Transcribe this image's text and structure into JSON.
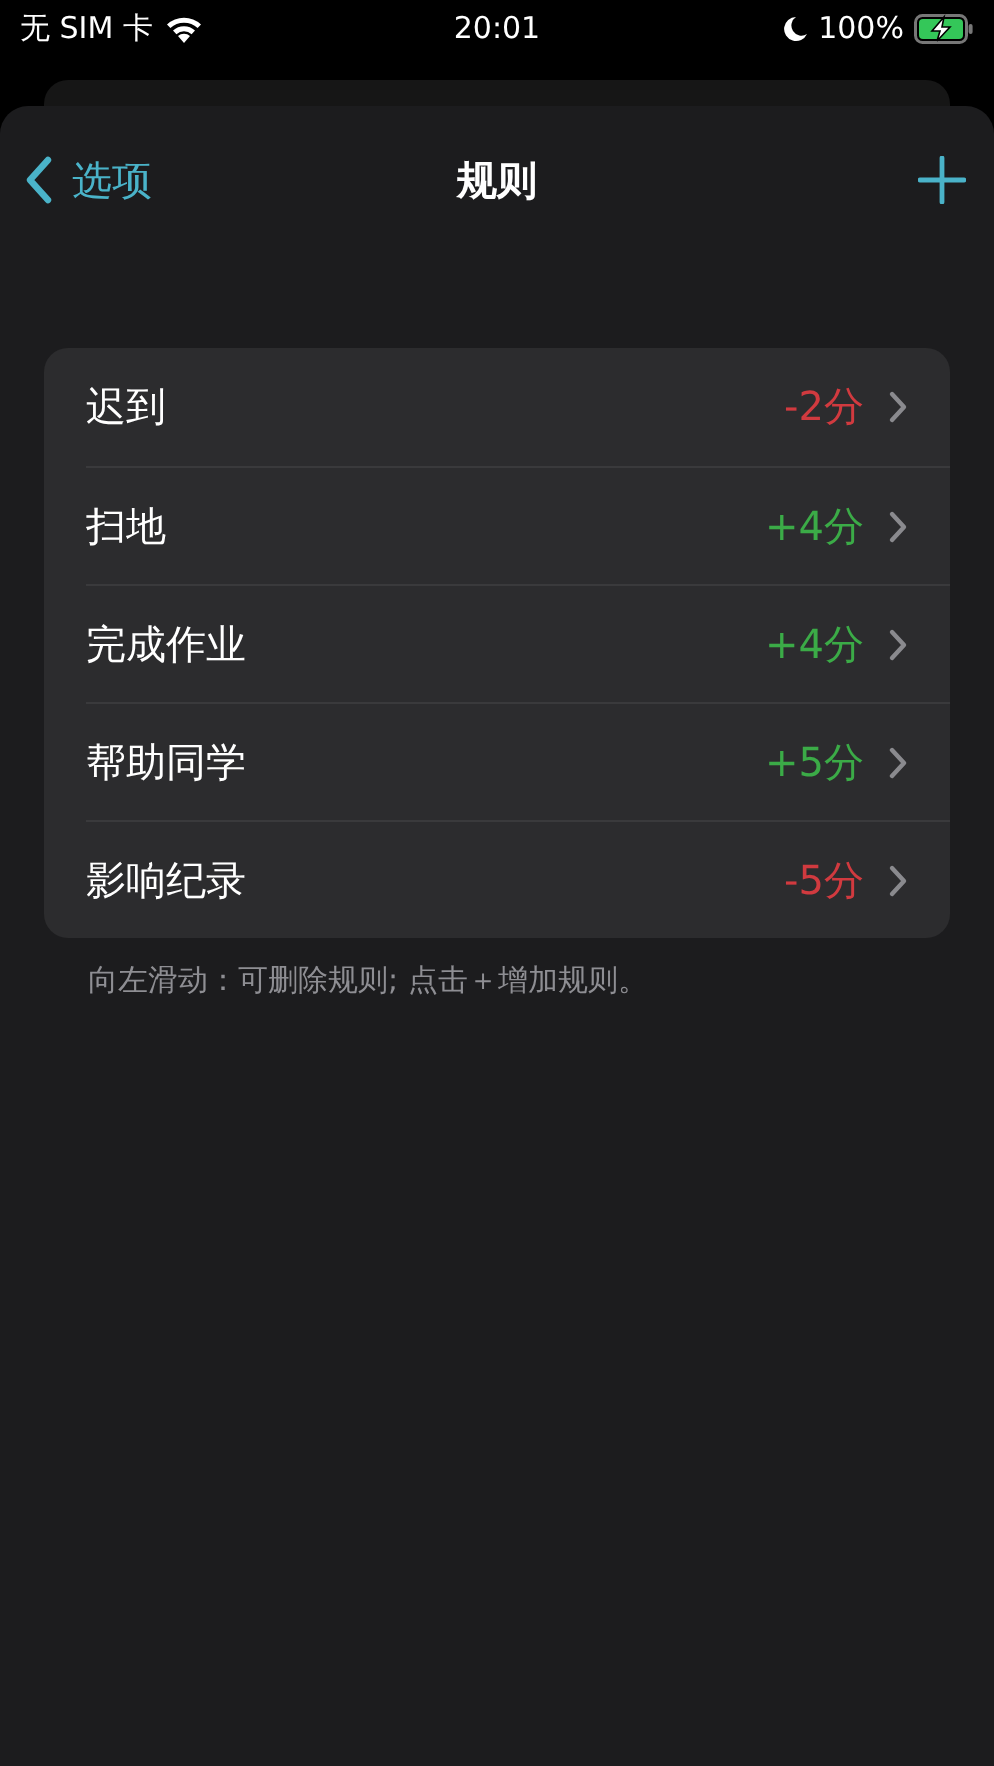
{
  "status_bar": {
    "carrier": "无 SIM 卡",
    "time": "20:01",
    "battery": "100%"
  },
  "nav": {
    "back": "选项",
    "title": "规则"
  },
  "rules": [
    {
      "name": "迟到",
      "score": "-2分",
      "color": "#d13a3f"
    },
    {
      "name": "扫地",
      "score": "+4分",
      "color": "#3bab47"
    },
    {
      "name": "完成作业",
      "score": "+4分",
      "color": "#3bab47"
    },
    {
      "name": "帮助同学",
      "score": "+5分",
      "color": "#3bab47"
    },
    {
      "name": "影响纪录",
      "score": "-5分",
      "color": "#d13a3f"
    }
  ],
  "footnote": "向左滑动：可删除规则; 点击＋增加规则。"
}
